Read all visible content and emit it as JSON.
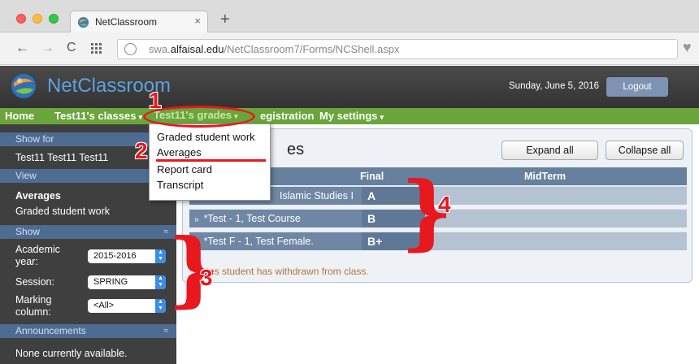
{
  "browser": {
    "tab_title": "NetClassroom",
    "tab_close": "×",
    "new_tab": "+",
    "url_prefix": "swa.",
    "url_domain": "alfaisal.edu",
    "url_path": "/NetClassroom7/Forms/NCShell.aspx"
  },
  "header": {
    "app_name": "NetClassroom",
    "date": "Sunday, June 5, 2016",
    "logout_label": "Logout"
  },
  "menu": {
    "home": "Home",
    "classes": "Test11's classes",
    "grades": "Test11's grades",
    "registration": "egistration",
    "settings": "My settings",
    "caret": "▾"
  },
  "dropdown": {
    "items": [
      "Graded student work",
      "Averages",
      "Report card",
      "Transcript"
    ]
  },
  "sidebar": {
    "show_for_heading": "Show for",
    "student_name": "Test11 Test11 Test11",
    "view_heading": "View",
    "view_selected": "Averages",
    "view_other": "Graded student work",
    "show_heading": "Show",
    "collapse_glyph": "≈",
    "academic_year_label": "Academic year:",
    "academic_year_value": "2015-2016",
    "session_label": "Session:",
    "session_value": "SPRING",
    "marking_label": "Marking column:",
    "marking_value": "<All>",
    "announcements_heading": "Announcements",
    "announcements_text": "None currently available."
  },
  "content": {
    "title": "es",
    "expand_all": "Expand all",
    "collapse_all": "Collapse all",
    "columns": {
      "final": "Final",
      "midterm": "MidTerm"
    },
    "rows": [
      {
        "chevron": "»",
        "name": "Islamic Studies I",
        "final": "A"
      },
      {
        "chevron": "»",
        "name": "*Test - 1, Test Course",
        "final": "B"
      },
      {
        "chevron": "»",
        "name": "*Test F - 1, Test Female.",
        "final": "B+"
      }
    ],
    "note": "cates student has withdrawn from class.",
    "note_star": "*"
  },
  "annotations": {
    "n1": "1",
    "n2": "2",
    "n3": "3",
    "n4": "4",
    "color": "#e8181f"
  },
  "colors": {
    "menu_green": "#6aa53c",
    "sidebar_heading": "#4e6b92",
    "grid_header": "#66809e",
    "logo_blue": "#5aa3e0"
  }
}
